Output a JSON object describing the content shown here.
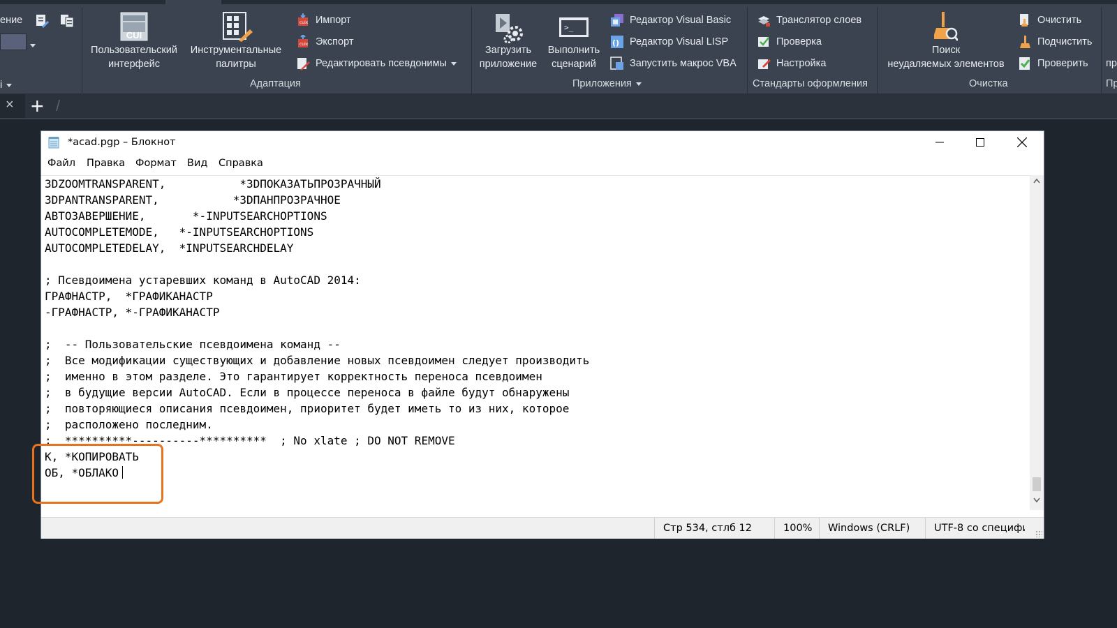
{
  "ribbon": {
    "left_cut": {
      "item1": "ение",
      "item3": "і"
    },
    "adaptation": {
      "cui_label": "Пользовательский\nинтерфейс",
      "cui_icon_text": "CUI",
      "palettes_label": "Инструментальные\nпалитры",
      "import_label": "Импорт",
      "export_label": "Экспорт",
      "aliases_label": "Редактировать псевдонимы",
      "panel_title": "Адаптация"
    },
    "applications": {
      "load_label": "Загрузить\nприложение",
      "run_label": "Выполнить\nсценарий",
      "vb_label": "Редактор Visual Basic",
      "lisp_label": "Редактор Visual LISP",
      "vba_label": "Запустить макрос VBA",
      "panel_title": "Приложения"
    },
    "standards": {
      "layer_translator_label": "Транслятор  слоев",
      "check_label": "Проверка",
      "settings_label": "Настройка",
      "panel_title": "Стандарты оформления"
    },
    "cleanup": {
      "find_label": "Поиск\nнеудаляемых элементов",
      "purge_label": "Очистить",
      "overkill_label": "Подчистить",
      "audit_label": "Проверить",
      "panel_title": "Очистка"
    },
    "right_cut": {
      "item1": "пр",
      "title": "Пр"
    }
  },
  "tabbar": {
    "close": "×",
    "add": "+",
    "slash": "/"
  },
  "notepad": {
    "title": "*acad.pgp – Блокнот",
    "menu": [
      "Файл",
      "Правка",
      "Формат",
      "Вид",
      "Справка"
    ],
    "lines": [
      "3DZOOMTRANSPARENT,           *3DПОКАЗАТЬПРОЗРАЧНЫЙ",
      "3DPANTRANSPARENT,           *3DПАНПРОЗРАЧНОЕ",
      "АВТОЗАВЕРШЕНИЕ,       *-INPUTSEARCHOPTIONS",
      "AUTOCOMPLETEMODE,   *-INPUTSEARCHOPTIONS",
      "AUTOCOMPLETEDELAY,  *INPUTSEARCHDELAY",
      "",
      "; Псевдоимена устаревших команд в AutoCAD 2014:",
      "ГРАФНАСТР,  *ГРАФИКАНАСТР",
      "-ГРАФНАСТР, *-ГРАФИКАНАСТР",
      "",
      ";  -- Пользовательские псевдоимена команд --",
      ";  Все модификации существующих и добавление новых псевдоимен следует производить",
      ";  именно в этом разделе. Это гарантирует корректность переноса псевдоимен",
      ";  в будущие версии AutoCAD. Если в процессе переноса в файле будут обнаружены",
      ";  повторяющиеся описания псевдоимен, приоритет будет иметь то из них, которое",
      ";  расположено последним.",
      ";  **********----------**********  ; No xlate ; DO NOT REMOVE",
      "К, *КОПИРОВАТЬ",
      "ОБ, *ОБЛАКО"
    ],
    "status": {
      "position": "Стр 534, стлб 12",
      "zoom": "100%",
      "line_endings": "Windows (CRLF)",
      "encoding": "UTF-8 со специфи"
    }
  },
  "colors": {
    "ribbon_bg": "#3b4350",
    "app_bg": "#1f252d",
    "highlight": "#e8731e"
  }
}
